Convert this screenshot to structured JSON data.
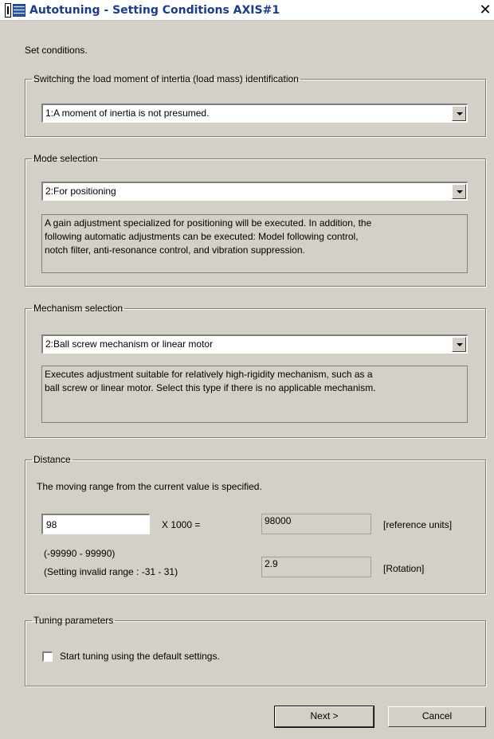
{
  "window": {
    "title": "Autotuning - Setting Conditions AXIS#1",
    "close_glyph": "✕"
  },
  "instruction": "Set conditions.",
  "identification_group": {
    "legend": "Switching the load moment of intertia (load mass) identification",
    "selected": "1:A moment of inertia is not presumed."
  },
  "mode_group": {
    "legend": "Mode selection",
    "selected": "2:For positioning",
    "description_lines": [
      "A gain adjustment specialized for positioning will be executed. In addition, the",
      "following automatic adjustments can be executed: Model following control,",
      "notch filter, anti-resonance control, and vibration suppression."
    ]
  },
  "mechanism_group": {
    "legend": "Mechanism selection",
    "selected": "2:Ball screw mechanism or linear motor",
    "description_lines": [
      "Executes adjustment suitable for relatively high-rigidity mechanism, such as a",
      "ball screw or linear motor. Select this type if there is no applicable mechanism."
    ]
  },
  "distance_group": {
    "legend": "Distance",
    "note": "The moving range from the current value is specified.",
    "input_value": "98",
    "multiplier": "X 1000 =",
    "reference_value": "98000",
    "reference_unit": "[reference units]",
    "range": "(-99990 - 99990)",
    "invalid_range": "(Setting invalid range : -31 - 31)",
    "rotation_value": "2.9",
    "rotation_unit": "[Rotation]"
  },
  "tuning_group": {
    "legend": "Tuning parameters",
    "checkbox_label": "Start tuning using the default settings.",
    "checked": false
  },
  "buttons": {
    "next": "Next >",
    "cancel": "Cancel"
  }
}
